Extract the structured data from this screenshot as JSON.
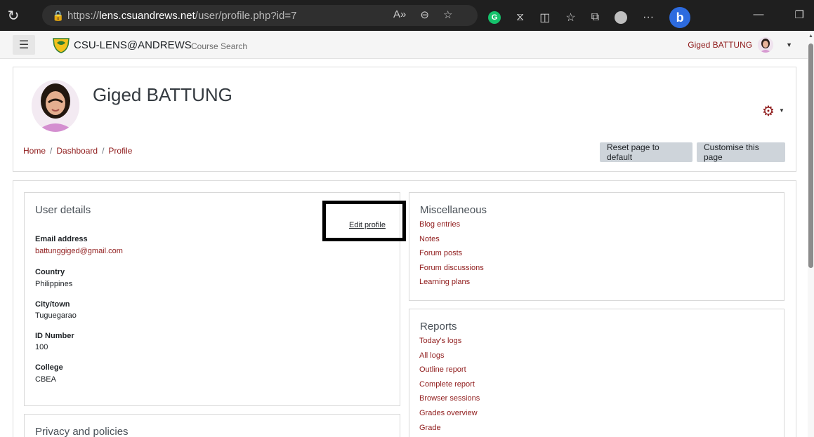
{
  "browser": {
    "url_scheme": "https://",
    "url_host": "lens.csuandrews.net",
    "url_path": "/user/profile.php?id=7",
    "reader_icon": "A»",
    "zoom_icon": "⊖",
    "favorite_icon": "☆",
    "extension_letter": "G",
    "more_icon": "···",
    "bing_letter": "b"
  },
  "navbar": {
    "site_name": "CSU-LENS@ANDREWS",
    "course_search": "Course Search",
    "user_name": "Giged BATTUNG",
    "menu_icon": "hamburger-icon"
  },
  "header": {
    "title": "Giged BATTUNG",
    "breadcrumb": [
      "Home",
      "Dashboard",
      "Profile"
    ],
    "breadcrumb_sep": "/",
    "reset_button": "Reset page to default",
    "customise_button": "Customise this page",
    "cog_symbol": "⚙"
  },
  "user_details": {
    "title": "User details",
    "edit_link": "Edit profile",
    "fields": [
      {
        "label": "Email address",
        "value": "battunggiged@gmail.com"
      },
      {
        "label": "Country",
        "value": "Philippines"
      },
      {
        "label": "City/town",
        "value": "Tuguegarao"
      },
      {
        "label": "ID Number",
        "value": "100"
      },
      {
        "label": "College",
        "value": "CBEA"
      }
    ]
  },
  "privacy": {
    "title": "Privacy and policies"
  },
  "misc": {
    "title": "Miscellaneous",
    "links": [
      "Blog entries",
      "Notes",
      "Forum posts",
      "Forum discussions",
      "Learning plans"
    ]
  },
  "reports": {
    "title": "Reports",
    "links": [
      "Today's logs",
      "All logs",
      "Outline report",
      "Complete report",
      "Browser sessions",
      "Grades overview",
      "Grade"
    ]
  },
  "colors": {
    "brand": "#8f1b1b",
    "button_grey": "#ced4da",
    "browser_dark": "#1f1f1f"
  }
}
